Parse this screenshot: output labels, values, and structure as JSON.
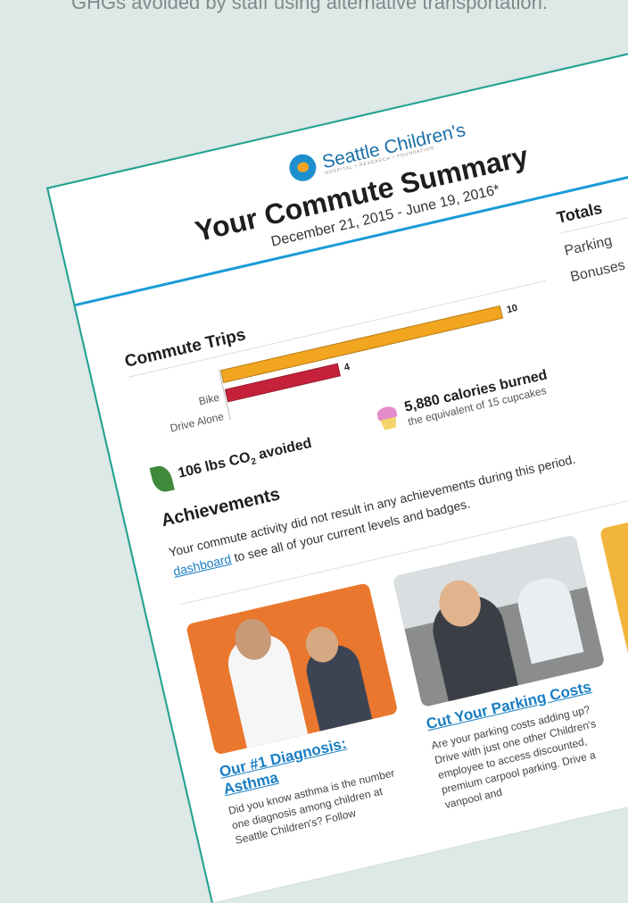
{
  "intro_text": "GHGs avoided by staff using alternative transportation.",
  "header": {
    "logo_text": "Seattle Children's",
    "logo_subtext": "HOSPITAL • RESEARCH • FOUNDATION",
    "title": "Your Commute Summary",
    "date_range": "December 21, 2015 - June 19, 2016*"
  },
  "totals": {
    "heading": "Totals",
    "rows": [
      "Parking",
      "Bonuses"
    ]
  },
  "commute_trips": {
    "heading": "Commute Trips",
    "bars": [
      {
        "label": "",
        "value": 10,
        "value_label": "10",
        "color": "#f2a51f"
      },
      {
        "label": "Bike",
        "value": 4,
        "value_label": "4",
        "color": "#c5213a"
      },
      {
        "label": "Drive Alone",
        "value": 0,
        "value_label": "",
        "color": "#c5213a"
      }
    ],
    "max": 10
  },
  "stats": {
    "co2": {
      "value": "106 lbs CO",
      "sub": "2",
      "suffix": " avoided"
    },
    "calories": {
      "value": "5,880 calories burned",
      "sub": "the equivalent of 15 cupcakes"
    }
  },
  "achievements": {
    "heading": "Achievements",
    "text": "Your commute activity did not result in any achievements during this period.",
    "text2_prefix": "",
    "link": "dashboard",
    "text2": " to see all of your current levels and badges."
  },
  "cards": [
    {
      "title": "Our #1 Diagnosis: Asthma",
      "text": "Did you know asthma is the number one diagnosis among children at Seattle Children's? Follow"
    },
    {
      "title": "Cut Your Parking Costs",
      "text": "Are your parking costs adding up? Drive with just one other Children's employee to access discounted, premium carpool parking. Drive a vanpool and"
    },
    {
      "title": "",
      "text": ""
    }
  ],
  "colors": {
    "accent": "#1ca091",
    "link": "#1a7ec4",
    "rule": "#1a9bd7"
  }
}
